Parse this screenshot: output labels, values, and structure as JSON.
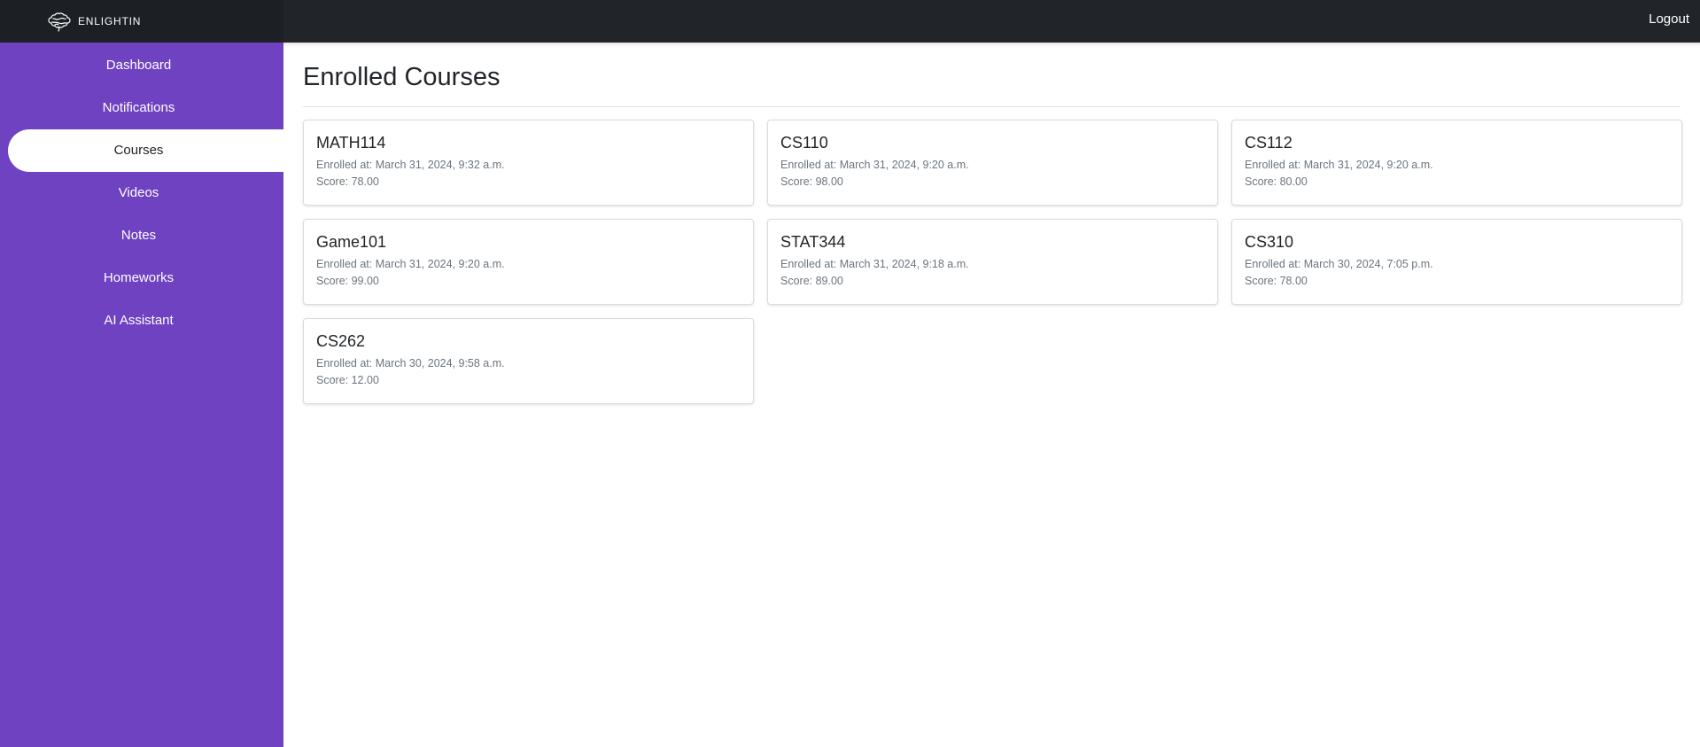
{
  "app": {
    "brand": "ENLIGHTIN",
    "logout_label": "Logout",
    "accent_color": "#6f42c1"
  },
  "sidebar": {
    "items": [
      {
        "label": "Dashboard",
        "active": false
      },
      {
        "label": "Notifications",
        "active": false
      },
      {
        "label": "Courses",
        "active": true
      },
      {
        "label": "Videos",
        "active": false
      },
      {
        "label": "Notes",
        "active": false
      },
      {
        "label": "Homeworks",
        "active": false
      },
      {
        "label": "AI Assistant",
        "active": false
      }
    ]
  },
  "main": {
    "title": "Enrolled Courses",
    "courses": [
      {
        "name": "MATH114",
        "enrolled": "Enrolled at: March 31, 2024, 9:32 a.m.",
        "score": "Score: 78.00"
      },
      {
        "name": "CS110",
        "enrolled": "Enrolled at: March 31, 2024, 9:20 a.m.",
        "score": "Score: 98.00"
      },
      {
        "name": "CS112",
        "enrolled": "Enrolled at: March 31, 2024, 9:20 a.m.",
        "score": "Score: 80.00"
      },
      {
        "name": "Game101",
        "enrolled": "Enrolled at: March 31, 2024, 9:20 a.m.",
        "score": "Score: 99.00"
      },
      {
        "name": "STAT344",
        "enrolled": "Enrolled at: March 31, 2024, 9:18 a.m.",
        "score": "Score: 89.00"
      },
      {
        "name": "CS310",
        "enrolled": "Enrolled at: March 30, 2024, 7:05 p.m.",
        "score": "Score: 78.00"
      },
      {
        "name": "CS262",
        "enrolled": "Enrolled at: March 30, 2024, 9:58 a.m.",
        "score": "Score: 12.00"
      }
    ]
  }
}
